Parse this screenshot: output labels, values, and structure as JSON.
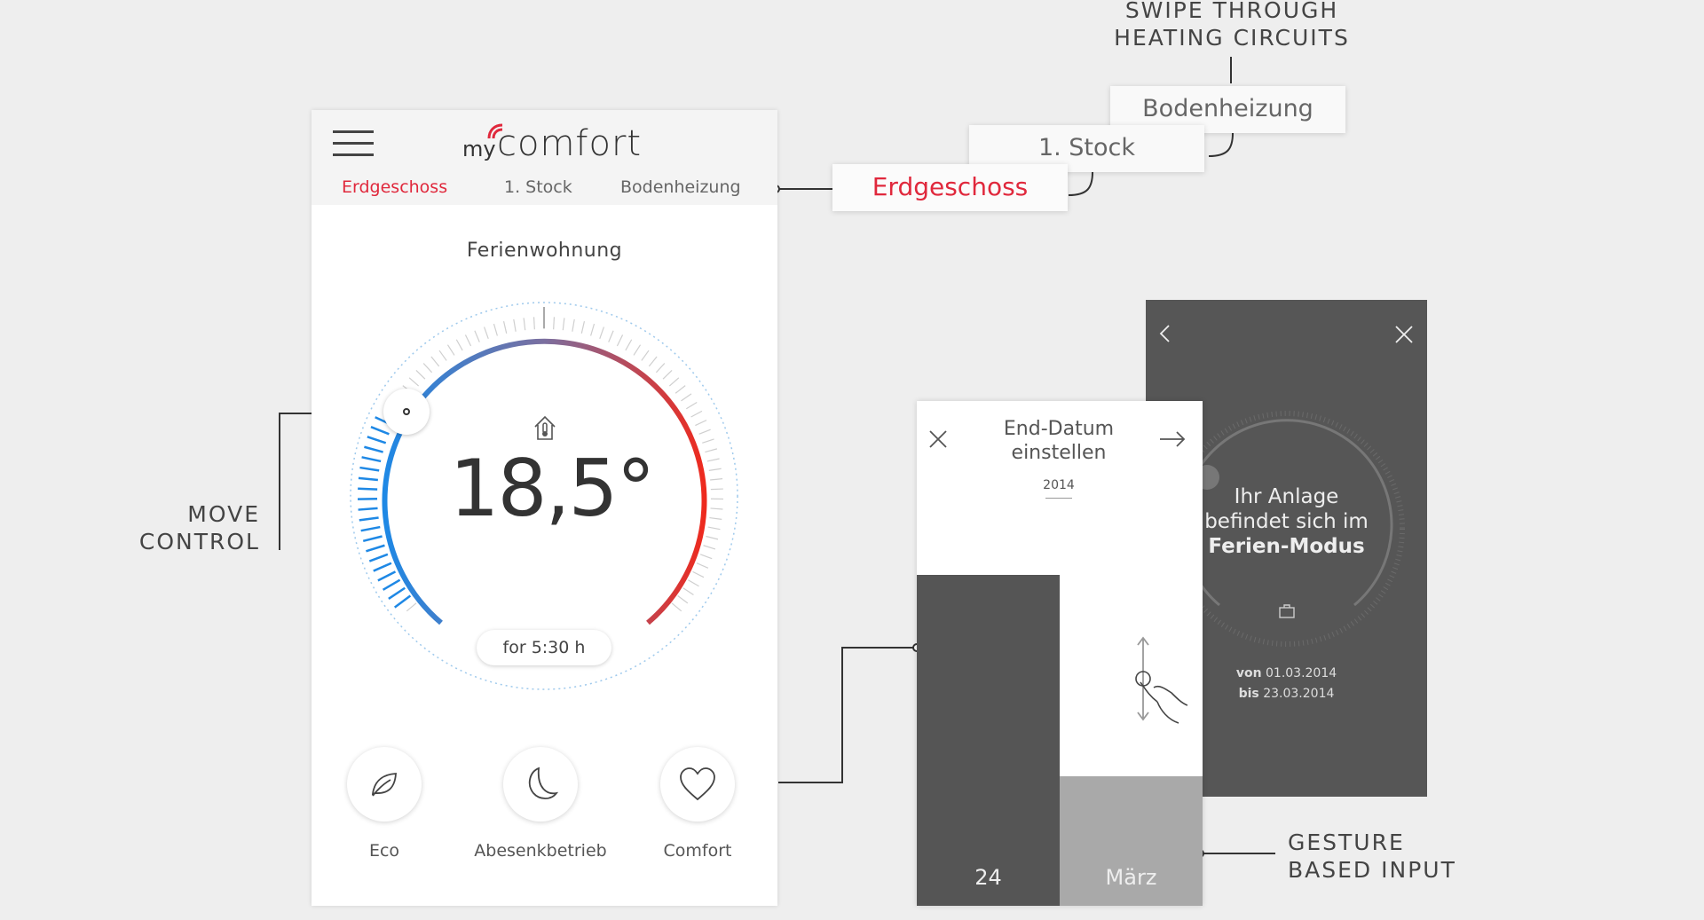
{
  "annotations": {
    "swipe_line1": "SWIPE THROUGH",
    "swipe_line2": "HEATING CIRCUITS",
    "move_line1": "MOVE",
    "move_line2": "CONTROL",
    "gesture_line1": "GESTURE",
    "gesture_line2": "BASED INPUT"
  },
  "app": {
    "brand_prefix": "my",
    "brand_name": "comfort",
    "tabs": [
      "Erdgeschoss",
      "1. Stock",
      "Bodenheizung"
    ],
    "active_tab": "Erdgeschoss",
    "location": "Ferienwohnung",
    "temperature": "18,5°",
    "timer": "for 5:30 h",
    "modes": [
      {
        "label": "Eco",
        "icon": "leaf-icon"
      },
      {
        "label": "Abesenkbetrieb",
        "icon": "moon-icon"
      },
      {
        "label": "Comfort",
        "icon": "heart-icon"
      }
    ]
  },
  "tab_cards": {
    "back": "Bodenheizung",
    "middle": "1. Stock",
    "front": "Erdgeschoss"
  },
  "vacation_screen": {
    "line1": "Ihr Anlage",
    "line2": "befindet sich im",
    "line3": "Ferien-Modus",
    "from_label": "von",
    "from_date": "01.03.2014",
    "to_label": "bis",
    "to_date": "23.03.2014"
  },
  "date_screen": {
    "title_line1": "End-Datum",
    "title_line2": "einstellen",
    "year": "2014",
    "day": "24",
    "month": "März"
  },
  "colors": {
    "accent_red": "#e0283c",
    "dial_cold": "#1e88e5",
    "dial_hot": "#ee2a1e",
    "dark_panel": "#565656"
  }
}
